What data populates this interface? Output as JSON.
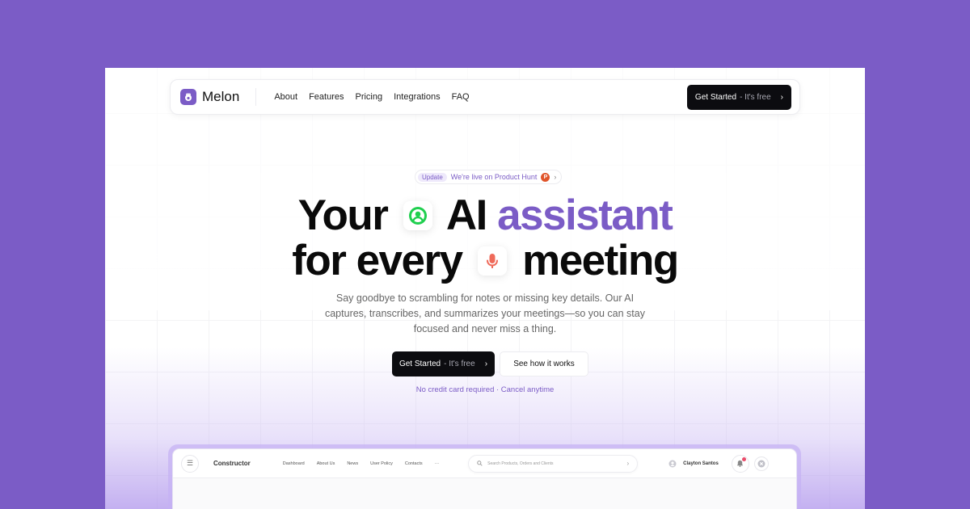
{
  "brand": {
    "name": "Melon",
    "accent": "#7b5cc6",
    "background": "#7b5cc6"
  },
  "nav": {
    "links": [
      "About",
      "Features",
      "Pricing",
      "Integrations",
      "FAQ"
    ],
    "cta_main": "Get Started",
    "cta_sub": "- It's free"
  },
  "badge": {
    "pill": "Update",
    "text": "We're live on Product Hunt",
    "icon": "producthunt-icon",
    "ph_letter": "P"
  },
  "hero": {
    "line1_a": "Your",
    "line1_b": "AI",
    "line1_c": "assistant",
    "line2_a": "for every",
    "line2_b": "meeting",
    "icon1": "user-circle-icon",
    "icon2": "microphone-icon",
    "subtitle": "Say goodbye to scrambling for notes or missing key details. Our AI captures, transcribes, and summarizes your meetings—so you can stay focused and never miss a thing."
  },
  "cta": {
    "primary_main": "Get Started",
    "primary_sub": "- It's free",
    "secondary": "See how it works",
    "note": "No credit card required · Cancel anytime"
  },
  "dashboard": {
    "title": "Constructor",
    "links": [
      "Dashboard",
      "About Us",
      "News",
      "User Policy",
      "Contacts"
    ],
    "more": "···",
    "search_placeholder": "Search Products, Orders and Clients",
    "user_name": "Clayton Santos"
  }
}
